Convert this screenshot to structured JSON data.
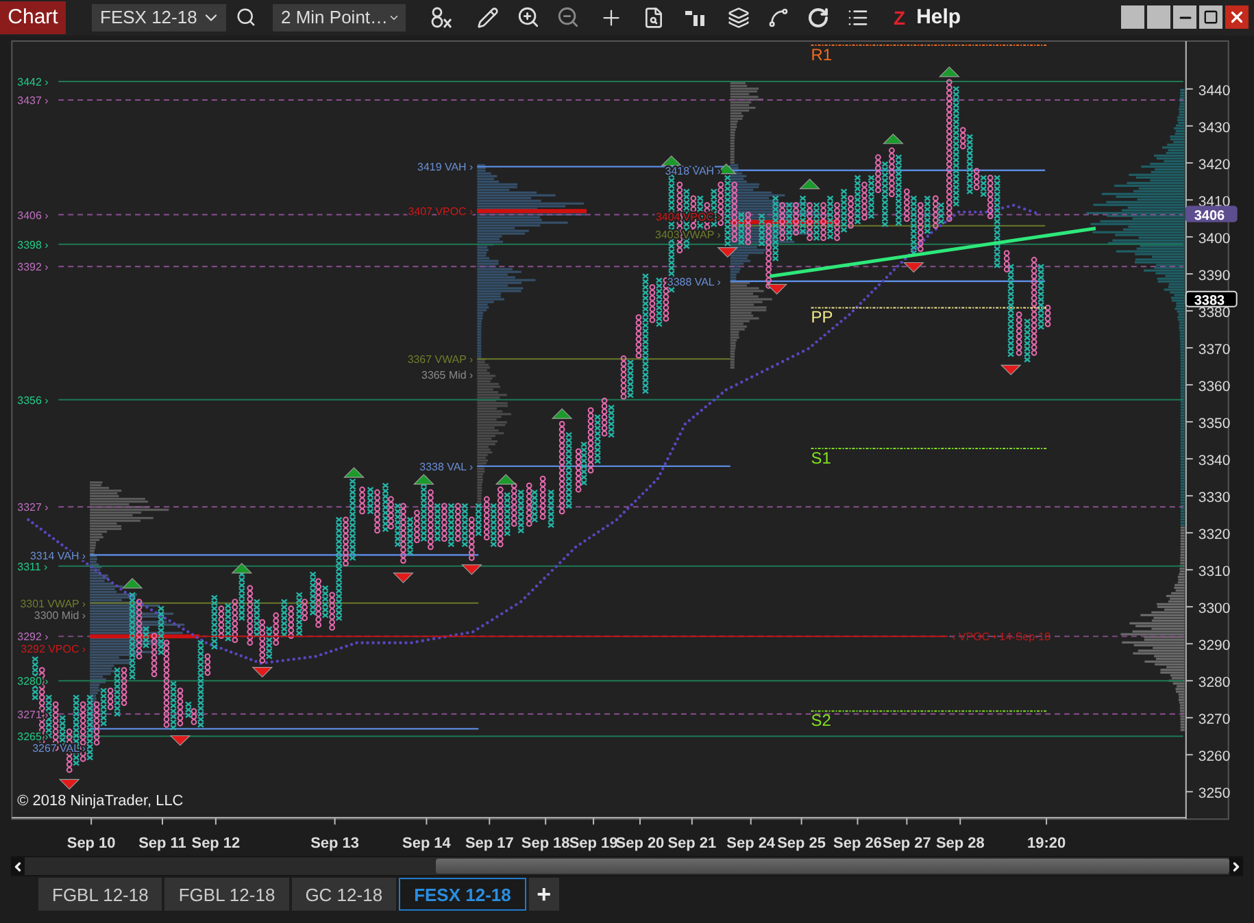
{
  "toolbar": {
    "title": "Chart",
    "instrument": "FESX 12-18",
    "interval": "2 Min Point…",
    "z_label": "Z",
    "help": "Help"
  },
  "levels": [
    {
      "label": "3442 ›",
      "kind": "solid"
    },
    {
      "label": "3437 ›",
      "kind": "dashed"
    },
    {
      "label": "3406 ›",
      "kind": "dashed"
    },
    {
      "label": "3398 ›",
      "kind": "solid"
    },
    {
      "label": "3392 ›",
      "kind": "dashed"
    },
    {
      "label": "3356 ›",
      "kind": "solid"
    },
    {
      "label": "3327 ›",
      "kind": "dashed"
    },
    {
      "label": "3311 ›",
      "kind": "solid"
    },
    {
      "label": "3292 ›",
      "kind": "dashed"
    },
    {
      "label": "3280 ›",
      "kind": "solid"
    },
    {
      "label": "3271 ›",
      "kind": "dashed"
    },
    {
      "label": "3265 ›",
      "kind": "solid"
    }
  ],
  "profiles": [
    {
      "labels": [
        {
          "label": "3314 VAH ›",
          "kind": "vah"
        },
        {
          "label": "3301 VWAP ›",
          "kind": "vwap"
        },
        {
          "label": "3300 Mid ›",
          "kind": "mid"
        },
        {
          "label": "3292 VPOC ›",
          "kind": "vpoc"
        },
        {
          "label": "3267 VAL ›",
          "kind": "val"
        }
      ]
    },
    {
      "labels": [
        {
          "label": "3419 VAH ›",
          "kind": "vah"
        },
        {
          "label": "3407 VPOC ›",
          "kind": "vpoc"
        },
        {
          "label": "3367 VWAP ›",
          "kind": "vwap"
        },
        {
          "label": "3365 Mid ›",
          "kind": "mid"
        },
        {
          "label": "3338 VAL ›",
          "kind": "val"
        }
      ]
    },
    {
      "labels": [
        {
          "label": "3418 VAH ›",
          "kind": "vah"
        },
        {
          "label": "3404 VPOC ›",
          "kind": "vpoc"
        },
        {
          "label": "3403 VWAP ›",
          "kind": "vwap"
        },
        {
          "label": "3388 VAL ›",
          "kind": "val"
        }
      ]
    }
  ],
  "naked_vpoc_label": "‹ VPOC • 14-Sep-18",
  "pivots": [
    {
      "label": "R1",
      "kind": "resistance"
    },
    {
      "label": "PP",
      "kind": "pivot"
    },
    {
      "label": "S1",
      "kind": "support"
    },
    {
      "label": "S2",
      "kind": "support"
    }
  ],
  "price_axis": {
    "ticks": [
      "3440",
      "3430",
      "3420",
      "3410",
      "3400",
      "3390",
      "3380",
      "3370",
      "3360",
      "3350",
      "3340",
      "3330",
      "3320",
      "3310",
      "3300",
      "3290",
      "3280",
      "3270",
      "3260",
      "3250"
    ],
    "markers": [
      {
        "label": "3406",
        "kind": "highlight"
      },
      {
        "label": "3383",
        "kind": "last"
      }
    ]
  },
  "date_axis": [
    "Sep 10",
    "Sep 11",
    "Sep 12",
    "Sep 13",
    "Sep 14",
    "Sep 17",
    "Sep 18",
    "Sep 19",
    "Sep 20",
    "Sep 21",
    "Sep 24",
    "Sep 25",
    "Sep 26",
    "Sep 27",
    "Sep 28",
    "19:20"
  ],
  "copyright": "© 2018 NinjaTrader, LLC",
  "tabs": [
    {
      "label": "FGBL 12-18",
      "selected": false
    },
    {
      "label": "FGBL 12-18",
      "selected": false
    },
    {
      "label": "GC 12-18",
      "selected": false
    },
    {
      "label": "FESX 12-18",
      "selected": true
    }
  ],
  "add_tab": "+"
}
